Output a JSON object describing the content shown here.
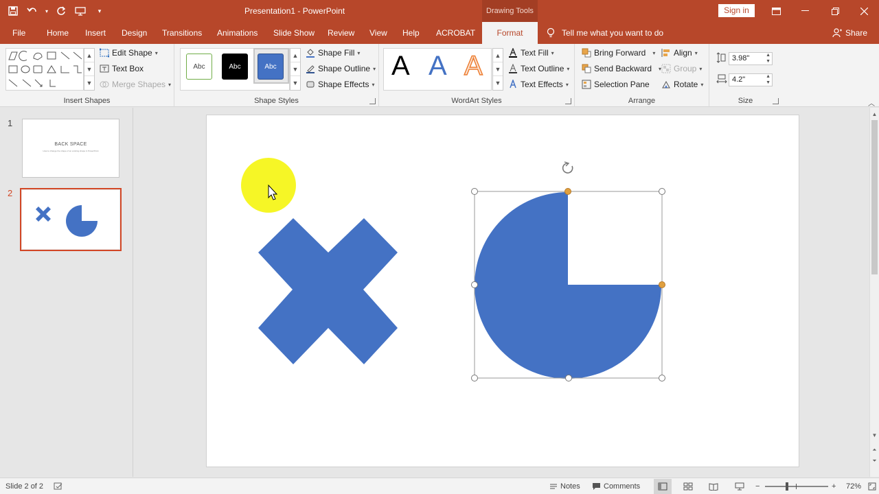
{
  "titlebar": {
    "title": "Presentation1  -  PowerPoint",
    "context_tab_group": "Drawing Tools",
    "sign_in": "Sign in"
  },
  "tabs": [
    {
      "label": "File"
    },
    {
      "label": "Home"
    },
    {
      "label": "Insert"
    },
    {
      "label": "Design"
    },
    {
      "label": "Transitions"
    },
    {
      "label": "Animations"
    },
    {
      "label": "Slide Show"
    },
    {
      "label": "Review"
    },
    {
      "label": "View"
    },
    {
      "label": "Help"
    },
    {
      "label": "ACROBAT"
    },
    {
      "label": "Format"
    }
  ],
  "tell_me": "Tell me what you want to do",
  "share": "Share",
  "ribbon": {
    "insert_shapes": {
      "edit_shape": "Edit Shape",
      "text_box": "Text Box",
      "merge_shapes": "Merge Shapes",
      "label": "Insert Shapes"
    },
    "shape_styles": {
      "style1": "Abc",
      "style2": "Abc",
      "style3": "Abc",
      "shape_fill": "Shape Fill",
      "shape_outline": "Shape Outline",
      "shape_effects": "Shape Effects",
      "label": "Shape Styles"
    },
    "wordart_styles": {
      "letter1": "A",
      "letter2": "A",
      "letter3": "A",
      "text_fill": "Text Fill",
      "text_outline": "Text Outline",
      "text_effects": "Text Effects",
      "label": "WordArt Styles"
    },
    "arrange": {
      "bring_forward": "Bring Forward",
      "send_backward": "Send Backward",
      "selection_pane": "Selection Pane",
      "align": "Align",
      "group": "Group",
      "rotate": "Rotate",
      "label": "Arrange"
    },
    "size": {
      "height": "3.98\"",
      "width": "4.2\"",
      "label": "Size"
    }
  },
  "slides": [
    {
      "number": "1",
      "title": "BACK SPACE",
      "subtitle": "How to change the shape of an existing shape in PowerPoint"
    },
    {
      "number": "2"
    }
  ],
  "status": {
    "slide_indicator": "Slide 2 of 2",
    "notes": "Notes",
    "comments": "Comments",
    "zoom": "72%"
  },
  "colors": {
    "accent": "#b7472a",
    "shape_fill": "#4472c4",
    "pointer_highlight": "#f5f500"
  }
}
